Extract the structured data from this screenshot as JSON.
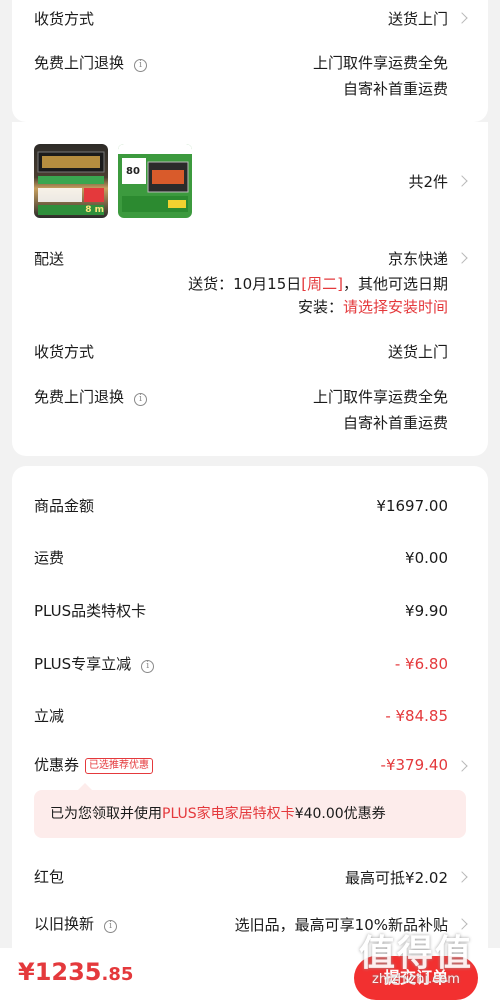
{
  "top_card": {
    "delivery_method_label": "收货方式",
    "delivery_method_value": "送货上门",
    "free_return_label": "免费上门退换",
    "free_return_line1": "上门取件享运费全免",
    "free_return_line2": "自寄补首重运费"
  },
  "group2": {
    "count_text": "共2件",
    "shipping_label": "配送",
    "shipping_value": "京东快递",
    "delivery_prefix": "送货：",
    "delivery_date": "10月15日",
    "delivery_weekday": "[周二]",
    "delivery_suffix": "，其他可选日期",
    "install_prefix": "安装：",
    "install_link": "请选择安装时间",
    "delivery_method_label": "收货方式",
    "delivery_method_value": "送货上门",
    "free_return_label": "免费上门退换",
    "free_return_line1": "上门取件享运费全免",
    "free_return_line2": "自寄补首重运费",
    "product1_badge": "8 m",
    "product2_badge": "80"
  },
  "summary": {
    "goods_amount_label": "商品金额",
    "goods_amount_value": "¥1697.00",
    "freight_label": "运费",
    "freight_value": "¥0.00",
    "plus_card_label": "PLUS品类特权卡",
    "plus_card_value": "¥9.90",
    "plus_discount_label": "PLUS专享立减",
    "plus_discount_value": "- ¥6.80",
    "instant_discount_label": "立减",
    "instant_discount_value": "- ¥84.85",
    "coupon_label": "优惠券",
    "coupon_tag": "已选推荐优惠",
    "coupon_value": "-¥379.40",
    "notice_prefix": "已为您领取并使用",
    "notice_highlight": "PLUS家电家居特权卡",
    "notice_suffix": "¥40.00优惠券",
    "red_packet_label": "红包",
    "red_packet_value": "最高可抵¥2.02",
    "trade_in_label": "以旧换新",
    "trade_in_value": "选旧品，最高可享10%新品补贴"
  },
  "bottom_bar": {
    "price_main": "¥1235",
    "price_decimal": ".85",
    "submit_label": "提交订单"
  },
  "watermark": {
    "text": "值得值",
    "url": "zhizhizhi.com"
  },
  "colors": {
    "accent_red": "#e4393c",
    "background": "#f2f2f2",
    "card": "#ffffff"
  }
}
